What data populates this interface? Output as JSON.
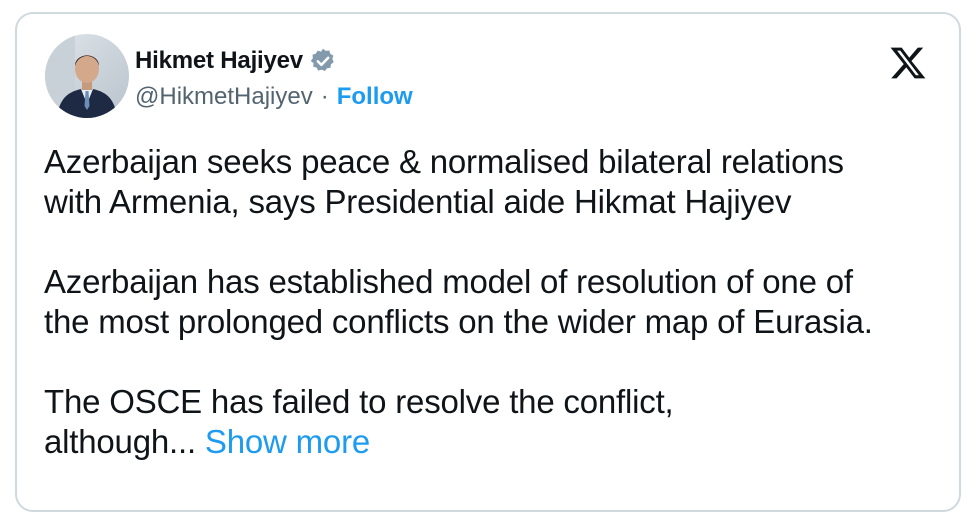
{
  "author": {
    "display_name": "Hikmet Hajiyev",
    "handle": "@HikmetHajiyev",
    "separator": "·",
    "follow_label": "Follow",
    "verified_icon": "verified-badge-icon",
    "platform_icon": "x-logo-icon"
  },
  "tweet": {
    "paragraphs": [
      "Azerbaijan seeks peace & normalised bilateral relations\nwith Armenia, says Presidential aide Hikmat Hajiyev",
      "Azerbaijan has established model of resolution of one of\nthe most prolonged conflicts on the wider map of Eurasia.",
      "The OSCE has failed to resolve the conflict,\nalthough..."
    ],
    "show_more_label": "Show more"
  },
  "colors": {
    "link_blue": "#1d9bf0",
    "text": "#0f1419",
    "muted": "#536471",
    "border": "#cfd9de",
    "verified_gray": "#829aab"
  }
}
